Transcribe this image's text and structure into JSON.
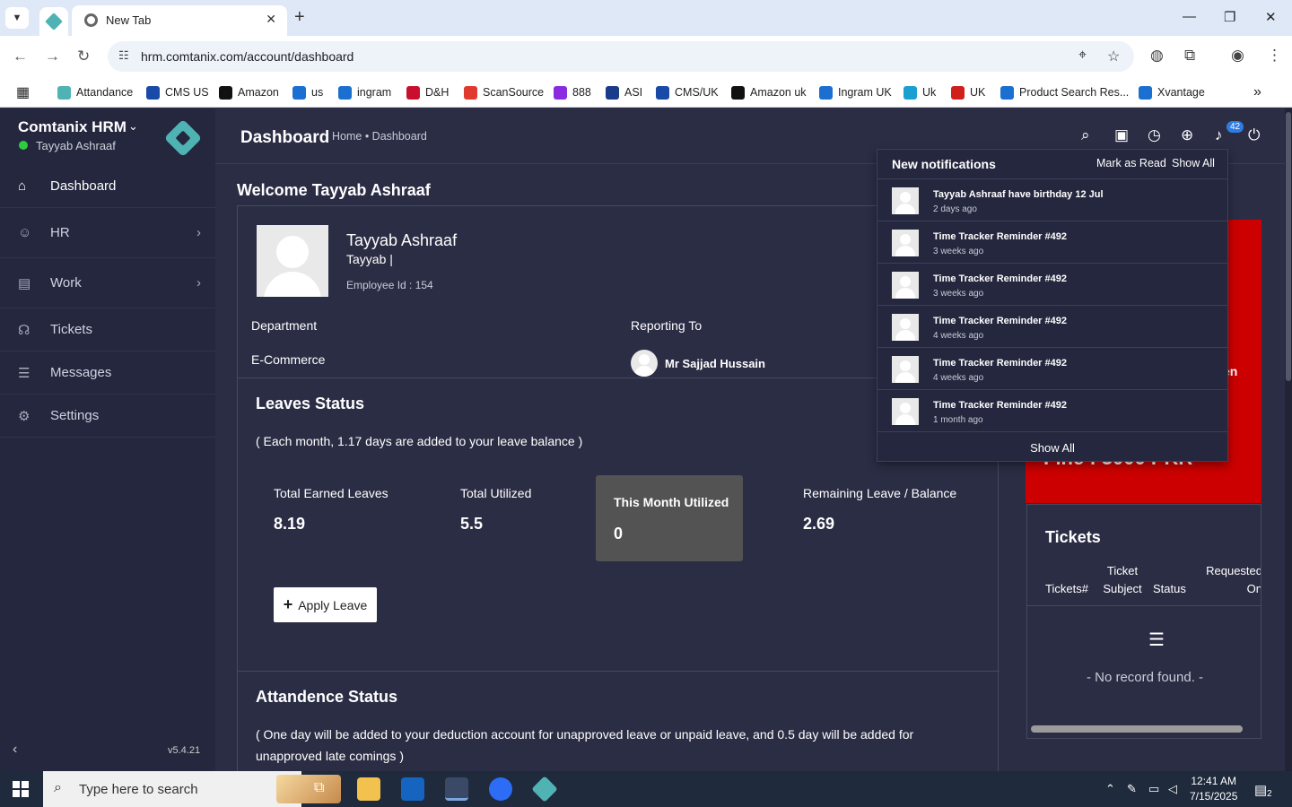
{
  "browser": {
    "tab_title": "New Tab",
    "url": "hrm.comtanix.com/account/dashboard",
    "bookmarks": [
      {
        "label": "Attandance",
        "color": "#4fb3b3"
      },
      {
        "label": "CMS US",
        "color": "#1a4aa8"
      },
      {
        "label": "Amazon",
        "color": "#111111"
      },
      {
        "label": "us",
        "color": "#1a6fd0"
      },
      {
        "label": "ingram",
        "color": "#1a6fd0"
      },
      {
        "label": "D&H",
        "color": "#c8102e"
      },
      {
        "label": "ScanSource",
        "color": "#e03a2f"
      },
      {
        "label": "888",
        "color": "#8a2be2"
      },
      {
        "label": "ASI",
        "color": "#1a3a8a"
      },
      {
        "label": "CMS/UK",
        "color": "#1a4aa8"
      },
      {
        "label": "Amazon uk",
        "color": "#111111"
      },
      {
        "label": "Ingram UK",
        "color": "#1a6fd0"
      },
      {
        "label": "Uk",
        "color": "#1aa0d0"
      },
      {
        "label": "UK",
        "color": "#d0201a"
      },
      {
        "label": "Product Search Res...",
        "color": "#1a6fd0"
      },
      {
        "label": "Xvantage",
        "color": "#1a6fd0"
      }
    ],
    "more": "»"
  },
  "sidebar": {
    "brand": "Comtanix HRM",
    "user": "Tayyab Ashraaf",
    "items": [
      {
        "label": "Dashboard",
        "icon": "⌂"
      },
      {
        "label": "HR",
        "icon": "☺"
      },
      {
        "label": "Work",
        "icon": "▤"
      },
      {
        "label": "Tickets",
        "icon": "☊"
      },
      {
        "label": "Messages",
        "icon": "☰"
      },
      {
        "label": "Settings",
        "icon": "⚙"
      }
    ],
    "version": "v5.4.21"
  },
  "header": {
    "title": "Dashboard",
    "breadcrumb": "Home • Dashboard",
    "notif_count": "42"
  },
  "welcome": "Welcome Tayyab Ashraaf",
  "profile": {
    "name": "Tayyab Ashraaf",
    "sub": "Tayyab |",
    "employee_id": "Employee Id : 154",
    "department_label": "Department",
    "department": "E-Commerce",
    "reporting_label": "Reporting To",
    "reporting_to": "Mr Sajjad Hussain"
  },
  "leaves": {
    "title": "Leaves Status",
    "note": "( Each month, 1.17 days are added to your leave balance )",
    "stats": [
      {
        "label": "Total Earned Leaves",
        "value": "8.19"
      },
      {
        "label": "Total Utilized",
        "value": "5.5"
      },
      {
        "label": "This Month Utilized",
        "value": "0"
      },
      {
        "label": "Remaining Leave / Balance",
        "value": "2.69"
      }
    ],
    "apply": "Apply Leave"
  },
  "attendance": {
    "title": "Attandence Status",
    "note": "( One day will be added to your deduction account for unapproved leave or unpaid leave, and 0.5 day will be added for unapproved late comings )"
  },
  "red_card": {
    "partial": "en",
    "fine": "Fine : 3000 PKR"
  },
  "tickets": {
    "title": "Tickets",
    "columns": [
      "Tickets#",
      "Ticket Subject",
      "Status",
      "Requested On"
    ],
    "empty": "- No record found. -"
  },
  "notifications": {
    "title": "New notifications",
    "mark_read": "Mark as Read",
    "show_all_top": "Show All",
    "items": [
      {
        "text": "Tayyab Ashraaf have birthday 12 Jul",
        "time": "2 days ago"
      },
      {
        "text": "Time Tracker Reminder #492",
        "time": "3 weeks ago"
      },
      {
        "text": "Time Tracker Reminder #492",
        "time": "3 weeks ago"
      },
      {
        "text": "Time Tracker Reminder #492",
        "time": "4 weeks ago"
      },
      {
        "text": "Time Tracker Reminder #492",
        "time": "4 weeks ago"
      },
      {
        "text": "Time Tracker Reminder #492",
        "time": "1 month ago"
      }
    ],
    "show_all_bottom": "Show All"
  },
  "taskbar": {
    "search_placeholder": "Type here to search",
    "time": "12:41 AM",
    "date": "7/15/2025",
    "notif_count": "2"
  }
}
